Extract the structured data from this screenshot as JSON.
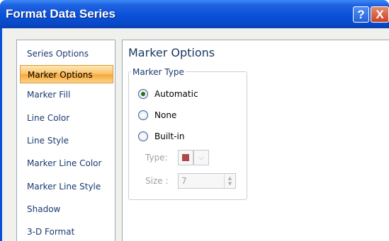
{
  "window": {
    "title": "Format Data Series",
    "help_glyph": "?",
    "close_glyph": "X"
  },
  "nav": {
    "items": [
      {
        "label": "Series Options",
        "selected": false
      },
      {
        "label": "Marker Options",
        "selected": true
      },
      {
        "label": "Marker Fill",
        "selected": false
      },
      {
        "label": "Line Color",
        "selected": false
      },
      {
        "label": "Line Style",
        "selected": false
      },
      {
        "label": "Marker Line Color",
        "selected": false
      },
      {
        "label": "Marker Line Style",
        "selected": false
      },
      {
        "label": "Shadow",
        "selected": false
      },
      {
        "label": "3-D Format",
        "selected": false
      }
    ]
  },
  "content": {
    "title": "Marker Options",
    "group_label": "Marker Type",
    "options": [
      {
        "label": "Automatic",
        "checked": true
      },
      {
        "label": "None",
        "checked": false
      },
      {
        "label": "Built-in",
        "checked": false
      }
    ],
    "type_label": "Type:",
    "type_swatch_color": "#b04848",
    "size_label": "Size :",
    "size_value": "7"
  },
  "colors": {
    "titlebar": "#0a50d8",
    "nav_selected": "#fbc56f"
  },
  "icons": {
    "help": "help-icon",
    "close": "close-icon",
    "dropdown": "chevron-down-icon",
    "spin": "spinner-arrows-icon"
  }
}
